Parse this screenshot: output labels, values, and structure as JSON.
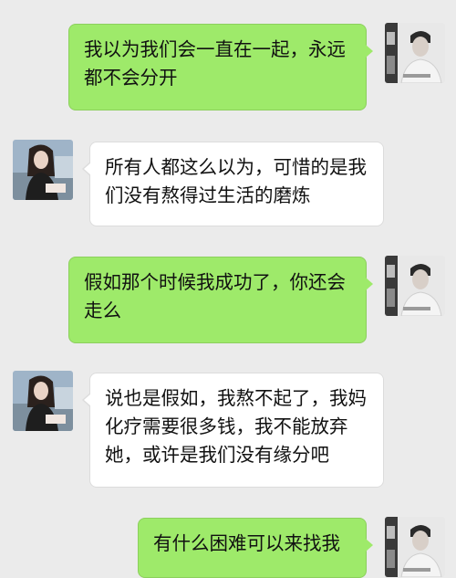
{
  "messages": [
    {
      "sender": "self",
      "text": "我以为我们会一直在一起，永远都不会分开"
    },
    {
      "sender": "other",
      "text": "所有人都这么以为，可惜的是我们没有熬得过生活的磨炼"
    },
    {
      "sender": "self",
      "text": "假如那个时候我成功了，你还会走么"
    },
    {
      "sender": "other",
      "text": "说也是假如，我熬不起了，我妈化疗需要很多钱，我不能放弃她，或许是我们没有缘分吧"
    },
    {
      "sender": "self",
      "text": "有什么困难可以来找我"
    }
  ],
  "colors": {
    "background": "#ebebeb",
    "sent_bubble": "#9eea6a",
    "received_bubble": "#ffffff"
  }
}
